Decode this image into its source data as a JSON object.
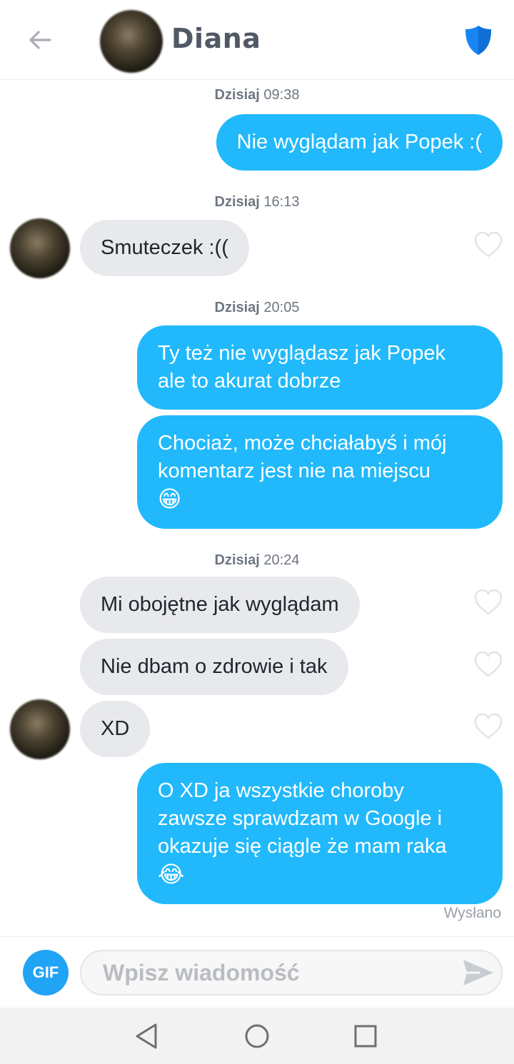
{
  "header": {
    "contact_name": "Diana",
    "back_icon": "arrow-left-icon",
    "safety_icon": "shield-icon",
    "accent_color": "#1786f4"
  },
  "messages": {
    "timestamps": [
      {
        "day": "Dzisiaj",
        "time": "09:38"
      },
      {
        "day": "Dzisiaj",
        "time": "16:13"
      },
      {
        "day": "Dzisiaj",
        "time": "20:05"
      },
      {
        "day": "Dzisiaj",
        "time": "20:24"
      }
    ],
    "m1": "Nie wyglądam jak Popek :(",
    "m2": "Smuteczek :((",
    "m3_line1": "Ty też nie wyglądasz jak Popek",
    "m3_line2": "ale to akurat dobrze",
    "m4_line1": "Chociaż, może chciałabyś i mój",
    "m4_line2": "komentarz jest nie na miejscu",
    "m4_emoji": "😁",
    "m5": "Mi obojętne jak wyglądam",
    "m6": "Nie dbam o zdrowie i tak",
    "m7": "XD",
    "m8_line1": "O XD ja wszystkie choroby",
    "m8_line2": "zawsze sprawdzam w Google i",
    "m8_line3": "okazuje się ciągle że mam raka",
    "m8_emoji": "😂",
    "status": "Wysłano"
  },
  "composer": {
    "gif_label": "GIF",
    "placeholder": "Wpisz wiadomość",
    "send_icon": "send-icon"
  },
  "colors": {
    "outgoing_bubble": "#21b9fb",
    "incoming_bubble": "#e8e9ec",
    "gif_button": "#21a3f6"
  },
  "navbar": {
    "icons": [
      "nav-back-icon",
      "nav-home-icon",
      "nav-recents-icon"
    ]
  }
}
